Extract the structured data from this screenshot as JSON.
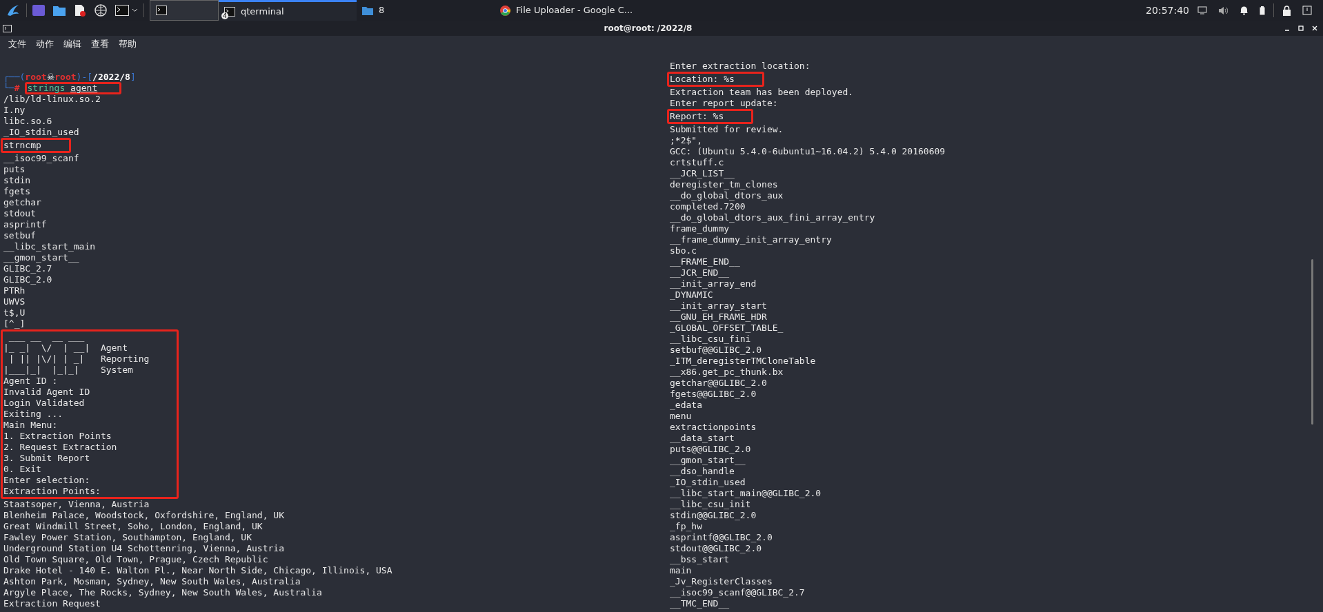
{
  "taskbar": {
    "windows": [
      {
        "kind": "icon",
        "selected": false
      },
      {
        "kind": "terminal",
        "label": "qterminal",
        "badge": "4",
        "selected": true
      },
      {
        "kind": "folder",
        "label": "8",
        "selected": false
      },
      {
        "kind": "browser",
        "label": "File Uploader - Google C...",
        "selected": false
      }
    ],
    "clock": "20:57:40"
  },
  "window": {
    "title": "root@root: /2022/8",
    "menu": [
      "文件",
      "动作",
      "编辑",
      "查看",
      "帮助"
    ]
  },
  "terminal": {
    "prompt": {
      "open": "┌──(",
      "mid": ")-[",
      "close": "]",
      "corner": "└─",
      "user": "root",
      "skull": "☠",
      "host": "root",
      "dir": "/2022/8",
      "symbol": "#",
      "command": "strings",
      "argument": "agent",
      "boxed": true
    },
    "left": [
      {
        "boxed": false,
        "lines": [
          "/lib/ld-linux.so.2",
          "I.ny",
          "libc.so.6",
          "_IO_stdin_used"
        ]
      },
      {
        "boxed": true,
        "lines": [
          "strncmp"
        ]
      },
      {
        "boxed": false,
        "lines": [
          "__isoc99_scanf",
          "puts",
          "stdin",
          "fgets",
          "getchar",
          "stdout",
          "asprintf",
          "setbuf",
          "__libc_start_main",
          "__gmon_start__",
          "GLIBC_2.7",
          "GLIBC_2.0",
          "PTRh",
          "UWVS",
          "t$,U",
          "[^_]"
        ]
      },
      {
        "boxed": true,
        "lines": [
          " ___ __  __ ___",
          "|_ _|  \\/  | __|  Agent",
          " | || |\\/| | _|   Reporting",
          "|___|_|  |_|_|    System",
          "Agent ID :",
          "Invalid Agent ID",
          "Login Validated",
          "Exiting ...",
          "Main Menu:",
          "1. Extraction Points",
          "2. Request Extraction",
          "3. Submit Report",
          "0. Exit",
          "Enter selection:",
          "Extraction Points:"
        ]
      },
      {
        "boxed": false,
        "lines": [
          "Staatsoper, Vienna, Austria",
          "Blenheim Palace, Woodstock, Oxfordshire, England, UK",
          "Great Windmill Street, Soho, London, England, UK",
          "Fawley Power Station, Southampton, England, UK",
          "Underground Station U4 Schottenring, Vienna, Austria",
          "Old Town Square, Old Town, Prague, Czech Republic",
          "Drake Hotel - 140 E. Walton Pl., Near North Side, Chicago, Illinois, USA",
          "Ashton Park, Mosman, Sydney, New South Wales, Australia",
          "Argyle Place, The Rocks, Sydney, New South Wales, Australia",
          "Extraction Request"
        ]
      }
    ],
    "right": [
      {
        "boxed": false,
        "lines": [
          "Enter extraction location:"
        ]
      },
      {
        "boxed": true,
        "lines": [
          "Location: %s"
        ]
      },
      {
        "boxed": false,
        "lines": [
          "Extraction team has been deployed.",
          "Enter report update:"
        ]
      },
      {
        "boxed": true,
        "lines": [
          "Report: %s"
        ]
      },
      {
        "boxed": false,
        "lines": [
          "Submitted for review.",
          ";*2$\",",
          "GCC: (Ubuntu 5.4.0-6ubuntu1~16.04.2) 5.4.0 20160609",
          "crtstuff.c",
          "__JCR_LIST__",
          "deregister_tm_clones",
          "__do_global_dtors_aux",
          "completed.7200",
          "__do_global_dtors_aux_fini_array_entry",
          "frame_dummy",
          "__frame_dummy_init_array_entry",
          "sbo.c",
          "__FRAME_END__",
          "__JCR_END__",
          "__init_array_end",
          "_DYNAMIC",
          "__init_array_start",
          "__GNU_EH_FRAME_HDR",
          "_GLOBAL_OFFSET_TABLE_",
          "__libc_csu_fini",
          "setbuf@@GLIBC_2.0",
          "_ITM_deregisterTMCloneTable",
          "__x86.get_pc_thunk.bx",
          "getchar@@GLIBC_2.0",
          "fgets@@GLIBC_2.0",
          "_edata",
          "menu",
          "extractionpoints",
          "__data_start",
          "puts@@GLIBC_2.0",
          "__gmon_start__",
          "__dso_handle",
          "_IO_stdin_used",
          "__libc_start_main@@GLIBC_2.0",
          "__libc_csu_init",
          "stdin@@GLIBC_2.0",
          "_fp_hw",
          "asprintf@@GLIBC_2.0",
          "stdout@@GLIBC_2.0",
          "__bss_start",
          "main",
          "_Jv_RegisterClasses",
          "__isoc99_scanf@@GLIBC_2.7",
          "__TMC_END__"
        ]
      }
    ]
  }
}
